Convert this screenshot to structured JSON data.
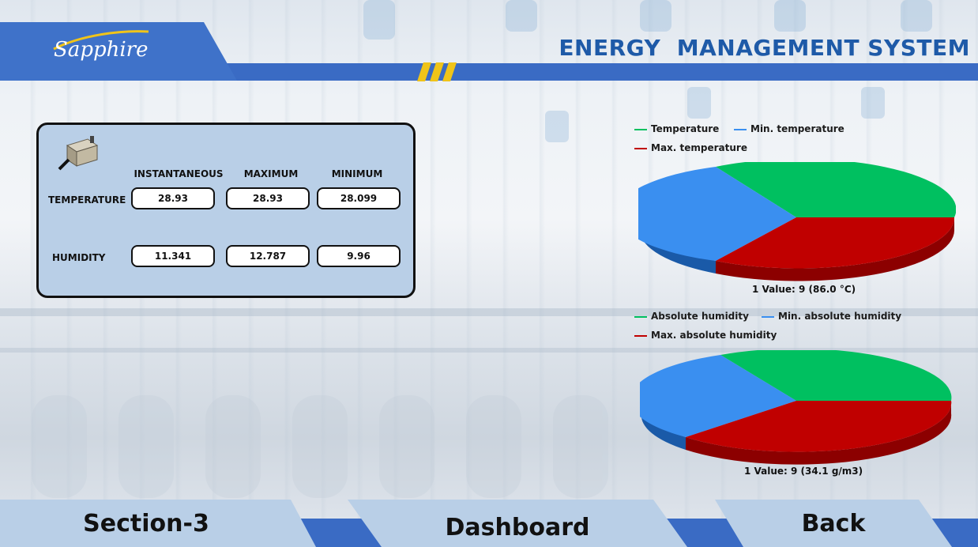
{
  "header": {
    "logo_text": "Sapphire",
    "title": "ENERGY  MANAGEMENT SYSTEM"
  },
  "panel": {
    "columns": [
      "INSTANTANEOUS",
      "MAXIMUM",
      "MINIMUM"
    ],
    "rows": [
      {
        "label": "TEMPERATURE",
        "values": [
          "28.93",
          "28.93",
          "28.099"
        ]
      },
      {
        "label": "HUMIDITY",
        "values": [
          "11.341",
          "12.787",
          "9.96"
        ]
      }
    ]
  },
  "temp_chart": {
    "legend": [
      {
        "name": "Temperature",
        "color": "#00c060"
      },
      {
        "name": "Min. temperature",
        "color": "#3a8ff0"
      },
      {
        "name": "Max. temperature",
        "color": "#c00000"
      }
    ],
    "caption": "1 Value: 9 (86.0 °C)"
  },
  "humidity_chart": {
    "legend": [
      {
        "name": "Absolute humidity",
        "color": "#00c060"
      },
      {
        "name": "Min. absolute humidity",
        "color": "#3a8ff0"
      },
      {
        "name": "Max. absolute humidity",
        "color": "#c00000"
      }
    ],
    "caption": "1 Value: 9 (34.1 g/m3)"
  },
  "nav": {
    "section": "Section-3",
    "dashboard": "Dashboard",
    "back": "Back"
  },
  "colors": {
    "brand_blue": "#3a6bc4",
    "title_blue": "#1e5aa8",
    "panel_bg": "#b9cfe7",
    "accent_yellow": "#f0c419"
  }
}
